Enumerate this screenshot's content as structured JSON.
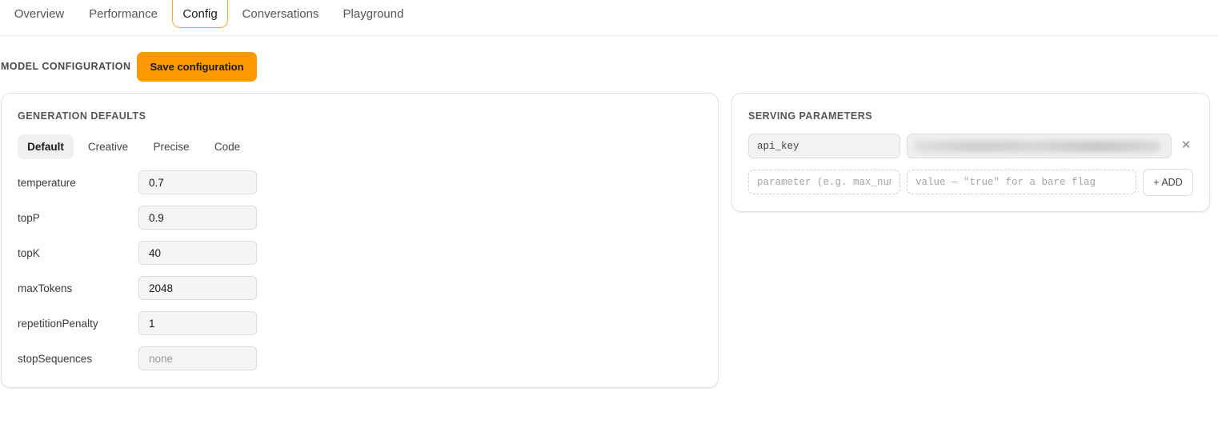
{
  "tabs": [
    "Overview",
    "Performance",
    "Config",
    "Conversations",
    "Playground"
  ],
  "active_tab": "Config",
  "config": {
    "section_title": "MODEL CONFIGURATION",
    "save_label": "Save configuration",
    "accent_color": "#ff9900"
  },
  "generation": {
    "title": "GENERATION DEFAULTS",
    "presets": [
      "Default",
      "Creative",
      "Precise",
      "Code"
    ],
    "active_preset": "Default",
    "params": [
      {
        "label": "temperature",
        "value": "0.7"
      },
      {
        "label": "topP",
        "value": "0.9"
      },
      {
        "label": "topK",
        "value": "40"
      },
      {
        "label": "maxTokens",
        "value": "2048"
      },
      {
        "label": "repetitionPenalty",
        "value": "1"
      },
      {
        "label": "stopSequences",
        "value": "",
        "placeholder": "none"
      }
    ]
  },
  "serving": {
    "title": "SERVING PARAMETERS",
    "entries": [
      {
        "key": "api_key",
        "value_redacted": true
      }
    ],
    "remove_icon": "close-icon",
    "new_key_placeholder": "parameter (e.g. max_num_",
    "new_value_placeholder": "value — \"true\" for a bare flag",
    "add_label": "+ ADD"
  }
}
